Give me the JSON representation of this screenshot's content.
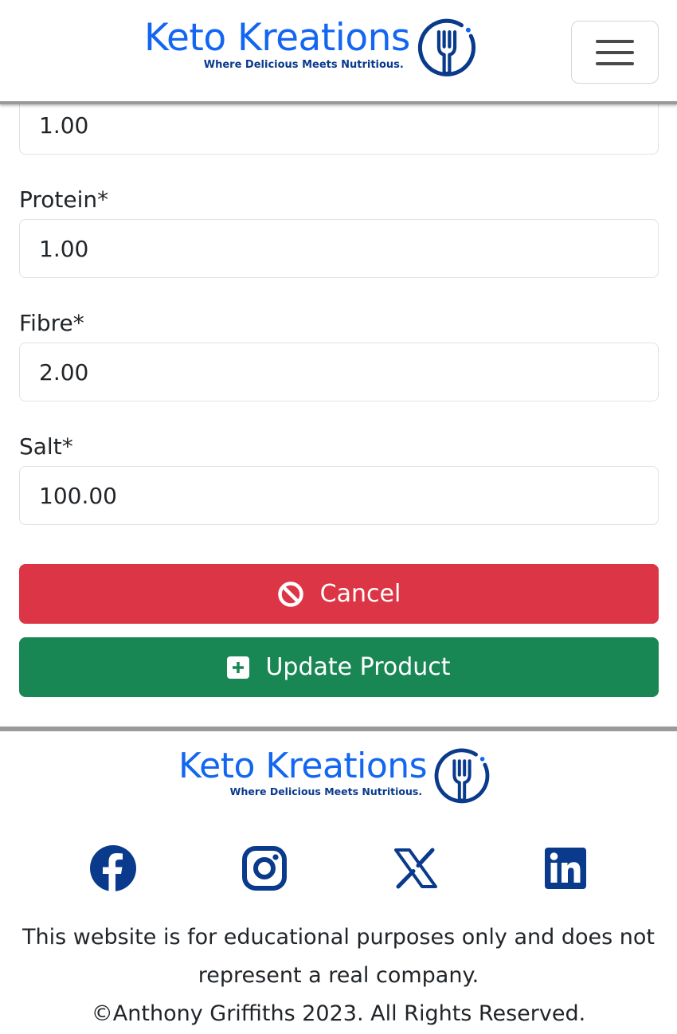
{
  "brand": {
    "name": "Keto Kreations",
    "tagline": "Where Delicious Meets Nutritious.",
    "primary_color": "#1266f1",
    "dark_color": "#0a3a8c"
  },
  "form": {
    "partial_value": "1.00",
    "fields": [
      {
        "label": "Protein*",
        "value": "1.00"
      },
      {
        "label": "Fibre*",
        "value": "2.00"
      },
      {
        "label": "Salt*",
        "value": "100.00"
      }
    ],
    "cancel_label": "Cancel",
    "update_label": "Update Product",
    "cancel_color": "#dc3545",
    "update_color": "#198754"
  },
  "social_icons": [
    "facebook-icon",
    "instagram-icon",
    "x-icon",
    "linkedin-icon"
  ],
  "footer": {
    "disclaimer_line1": "This website is for educational purposes only and does not",
    "disclaimer_line2": "represent a real company.",
    "copyright": "©Anthony Griffiths 2023. All Rights Reserved."
  }
}
